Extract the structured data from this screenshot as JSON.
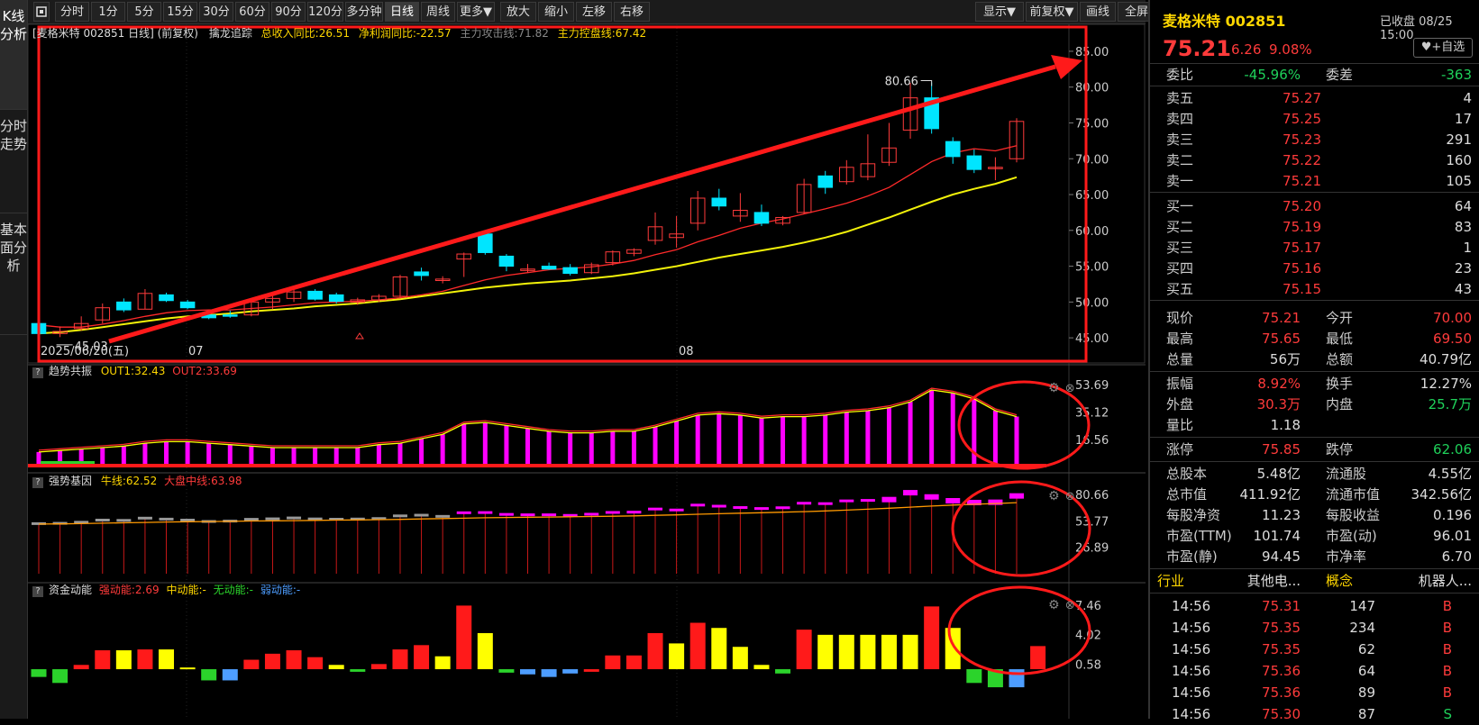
{
  "side_tabs": [
    {
      "label": "K线分析",
      "active": true
    },
    {
      "label": "分时走势",
      "active": false
    },
    {
      "label": "基本面分析",
      "active": false
    }
  ],
  "toolbar": {
    "collapse_icon": "square-icon",
    "periods": [
      "分时",
      "1分",
      "5分",
      "15分",
      "30分",
      "60分",
      "90分",
      "120分",
      "多分钟",
      "日线",
      "周线",
      "更多▼"
    ],
    "active_period": "日线",
    "actions": [
      "放大",
      "缩小",
      "左移",
      "右移"
    ],
    "right_actions": [
      "显示▼",
      "前复权▼",
      "画线",
      "全屏"
    ]
  },
  "main_chart": {
    "header": {
      "title": "[麦格米特 002851 日线] (前复权)",
      "indicator": "擒龙追踪",
      "revenue_label": "总收入同比:26.51",
      "profit_label": "净利润同比:-22.57",
      "attack_label": "主力攻击线:71.82",
      "control_label": "主力控盘线:67.42"
    },
    "price_axis": [
      "85.00",
      "80.00",
      "75.00",
      "70.00",
      "65.00",
      "60.00",
      "55.00",
      "50.00",
      "45.00"
    ],
    "date_labels": [
      "2025/06/20(五)",
      "07",
      "08"
    ],
    "high_marker": "80.66",
    "low_marker": "45.03"
  },
  "chart_data": {
    "type": "candlestick",
    "ylim": [
      42.5,
      86.5
    ],
    "candles": [
      {
        "o": 47.0,
        "h": 47.4,
        "l": 45.5,
        "c": 45.6,
        "up": false
      },
      {
        "o": 45.6,
        "h": 46.6,
        "l": 45.1,
        "c": 45.9,
        "up": true
      },
      {
        "o": 46.3,
        "h": 48.0,
        "l": 46.0,
        "c": 47.0,
        "up": true
      },
      {
        "o": 47.5,
        "h": 49.8,
        "l": 47.0,
        "c": 49.2,
        "up": true
      },
      {
        "o": 50.0,
        "h": 50.5,
        "l": 48.6,
        "c": 48.9,
        "up": false
      },
      {
        "o": 49.0,
        "h": 51.8,
        "l": 49.0,
        "c": 51.2,
        "up": true
      },
      {
        "o": 51.0,
        "h": 51.3,
        "l": 50.0,
        "c": 50.2,
        "up": false
      },
      {
        "o": 50.0,
        "h": 50.3,
        "l": 49.0,
        "c": 49.2,
        "up": false
      },
      {
        "o": 48.2,
        "h": 48.7,
        "l": 47.6,
        "c": 47.8,
        "up": false
      },
      {
        "o": 48.2,
        "h": 48.8,
        "l": 47.8,
        "c": 48.2,
        "up": false
      },
      {
        "o": 48.2,
        "h": 50.5,
        "l": 48.0,
        "c": 50.0,
        "up": true
      },
      {
        "o": 50.0,
        "h": 51.0,
        "l": 49.0,
        "c": 50.5,
        "up": true
      },
      {
        "o": 50.5,
        "h": 52.0,
        "l": 50.0,
        "c": 51.4,
        "up": true
      },
      {
        "o": 51.5,
        "h": 51.8,
        "l": 50.2,
        "c": 50.4,
        "up": false
      },
      {
        "o": 51.0,
        "h": 51.3,
        "l": 49.8,
        "c": 50.1,
        "up": false
      },
      {
        "o": 50.0,
        "h": 50.6,
        "l": 49.6,
        "c": 50.3,
        "up": true
      },
      {
        "o": 50.3,
        "h": 51.1,
        "l": 50.0,
        "c": 50.8,
        "up": true
      },
      {
        "o": 50.8,
        "h": 53.8,
        "l": 50.5,
        "c": 53.5,
        "up": true
      },
      {
        "o": 53.7,
        "h": 54.8,
        "l": 53.0,
        "c": 54.2,
        "up": false
      },
      {
        "o": 53.2,
        "h": 53.6,
        "l": 52.6,
        "c": 53.0,
        "up": true
      },
      {
        "o": 56.0,
        "h": 56.9,
        "l": 53.5,
        "c": 56.7,
        "up": true
      },
      {
        "o": 59.5,
        "h": 59.8,
        "l": 56.6,
        "c": 56.9,
        "up": false
      },
      {
        "o": 56.4,
        "h": 56.7,
        "l": 54.3,
        "c": 55.0,
        "up": false
      },
      {
        "o": 54.4,
        "h": 55.3,
        "l": 54.1,
        "c": 54.6,
        "up": true
      },
      {
        "o": 55.0,
        "h": 55.5,
        "l": 54.5,
        "c": 54.6,
        "up": false
      },
      {
        "o": 54.8,
        "h": 55.3,
        "l": 53.7,
        "c": 54.0,
        "up": false
      },
      {
        "o": 54.1,
        "h": 55.5,
        "l": 53.9,
        "c": 55.2,
        "up": true
      },
      {
        "o": 55.5,
        "h": 57.2,
        "l": 55.1,
        "c": 57.0,
        "up": true
      },
      {
        "o": 56.8,
        "h": 57.5,
        "l": 56.4,
        "c": 57.3,
        "up": true
      },
      {
        "o": 58.6,
        "h": 62.5,
        "l": 58.0,
        "c": 60.5,
        "up": true
      },
      {
        "o": 59.0,
        "h": 62.0,
        "l": 57.6,
        "c": 59.5,
        "up": true
      },
      {
        "o": 61.0,
        "h": 65.5,
        "l": 60.0,
        "c": 64.5,
        "up": true
      },
      {
        "o": 64.5,
        "h": 65.8,
        "l": 62.8,
        "c": 63.4,
        "up": false
      },
      {
        "o": 62.8,
        "h": 65.2,
        "l": 61.2,
        "c": 62.0,
        "up": true
      },
      {
        "o": 62.5,
        "h": 63.6,
        "l": 60.6,
        "c": 61.0,
        "up": false
      },
      {
        "o": 61.0,
        "h": 62.0,
        "l": 60.7,
        "c": 61.8,
        "up": true
      },
      {
        "o": 62.5,
        "h": 67.2,
        "l": 62.3,
        "c": 66.4,
        "up": true
      },
      {
        "o": 67.6,
        "h": 68.3,
        "l": 65.1,
        "c": 66.0,
        "up": false
      },
      {
        "o": 66.8,
        "h": 69.8,
        "l": 66.4,
        "c": 68.8,
        "up": true
      },
      {
        "o": 67.5,
        "h": 73.4,
        "l": 67.0,
        "c": 69.3,
        "up": true
      },
      {
        "o": 69.5,
        "h": 75.0,
        "l": 69.0,
        "c": 71.5,
        "up": true
      },
      {
        "o": 74.0,
        "h": 80.6,
        "l": 72.8,
        "c": 78.5,
        "up": true
      },
      {
        "o": 78.5,
        "h": 80.66,
        "l": 73.5,
        "c": 74.2,
        "up": false
      },
      {
        "o": 72.4,
        "h": 73.0,
        "l": 69.3,
        "c": 70.3,
        "up": false
      },
      {
        "o": 70.4,
        "h": 71.3,
        "l": 68.0,
        "c": 68.5,
        "up": false
      },
      {
        "o": 68.7,
        "h": 70.2,
        "l": 67.0,
        "c": 68.8,
        "up": true
      },
      {
        "o": 70.0,
        "h": 75.65,
        "l": 69.5,
        "c": 75.21,
        "up": true
      }
    ],
    "ma_short": [
      46.8,
      46.5,
      46.5,
      46.9,
      47.4,
      48.0,
      48.5,
      48.8,
      48.9,
      48.9,
      49.1,
      49.3,
      49.6,
      49.9,
      50.0,
      50.1,
      50.3,
      50.6,
      51.0,
      51.5,
      52.3,
      53.1,
      53.7,
      54.1,
      54.5,
      54.7,
      54.9,
      55.3,
      55.8,
      56.6,
      57.3,
      58.4,
      59.3,
      60.3,
      61.0,
      61.6,
      62.3,
      63.0,
      63.8,
      64.8,
      66.0,
      67.8,
      69.6,
      70.8,
      71.4,
      71.1,
      71.82
    ],
    "ma_long": [
      45.6,
      45.8,
      46.1,
      46.5,
      46.9,
      47.3,
      47.7,
      48.0,
      48.2,
      48.4,
      48.7,
      48.9,
      49.1,
      49.4,
      49.6,
      49.8,
      50.1,
      50.4,
      50.8,
      51.2,
      51.6,
      52.0,
      52.3,
      52.6,
      52.8,
      53.0,
      53.3,
      53.6,
      54.0,
      54.5,
      55.0,
      55.6,
      56.2,
      56.7,
      57.2,
      57.7,
      58.3,
      59.0,
      59.8,
      60.8,
      61.8,
      62.9,
      64.0,
      65.0,
      65.8,
      66.5,
      67.42
    ],
    "trend_resonance": {
      "name": "趋势共振",
      "out1": "OUT1:32.43",
      "out2": "OUT2:33.69",
      "axis": [
        "53.69",
        "35.12",
        "16.56"
      ],
      "ylim": [
        0,
        53.69
      ],
      "values": [
        8,
        9,
        10,
        11,
        12,
        14,
        15,
        15,
        14,
        13,
        12,
        11,
        11,
        11,
        11,
        11,
        13,
        14,
        17,
        20,
        27,
        28,
        26,
        24,
        22,
        21,
        21,
        22,
        22,
        25,
        29,
        33,
        34,
        33,
        31,
        32,
        32,
        33,
        35,
        36,
        38,
        42,
        50,
        48,
        44,
        36,
        32
      ]
    },
    "strong_gene": {
      "name": "强势基因",
      "bull_label": "牛线:62.52",
      "market_label": "大盘中线:63.98",
      "axis": [
        "80.66",
        "53.77",
        "26.89"
      ],
      "ylim": [
        0,
        90
      ]
    },
    "capital_momentum": {
      "name": "资金动能",
      "strong": "强动能:2.69",
      "medium": "中动能:-",
      "none": "无动能:-",
      "weak": "弱动能:-",
      "axis": [
        "7.46",
        "4.02",
        "0.58"
      ],
      "ylim": [
        -2.3,
        8.7
      ],
      "bars": [
        {
          "v": -0.9,
          "c": "green"
        },
        {
          "v": -1.6,
          "c": "green"
        },
        {
          "v": 0.5,
          "c": "red"
        },
        {
          "v": 2.2,
          "c": "red"
        },
        {
          "v": 2.2,
          "c": "yellow"
        },
        {
          "v": 2.3,
          "c": "red"
        },
        {
          "v": 2.3,
          "c": "yellow"
        },
        {
          "v": 0.2,
          "c": "yellow"
        },
        {
          "v": -1.3,
          "c": "green"
        },
        {
          "v": -1.3,
          "c": "blue"
        },
        {
          "v": 1.1,
          "c": "red"
        },
        {
          "v": 1.8,
          "c": "red"
        },
        {
          "v": 2.2,
          "c": "red"
        },
        {
          "v": 1.4,
          "c": "red"
        },
        {
          "v": 0.5,
          "c": "yellow"
        },
        {
          "v": -0.3,
          "c": "green"
        },
        {
          "v": 0.6,
          "c": "red"
        },
        {
          "v": 2.3,
          "c": "red"
        },
        {
          "v": 2.8,
          "c": "red"
        },
        {
          "v": 1.5,
          "c": "yellow"
        },
        {
          "v": 7.4,
          "c": "red"
        },
        {
          "v": 4.2,
          "c": "yellow"
        },
        {
          "v": -0.4,
          "c": "green"
        },
        {
          "v": -0.6,
          "c": "blue"
        },
        {
          "v": -0.9,
          "c": "blue"
        },
        {
          "v": -0.5,
          "c": "blue"
        },
        {
          "v": -0.3,
          "c": "red"
        },
        {
          "v": 1.6,
          "c": "red"
        },
        {
          "v": 1.6,
          "c": "red"
        },
        {
          "v": 4.2,
          "c": "red"
        },
        {
          "v": 3.0,
          "c": "yellow"
        },
        {
          "v": 5.4,
          "c": "red"
        },
        {
          "v": 4.8,
          "c": "yellow"
        },
        {
          "v": 2.6,
          "c": "yellow"
        },
        {
          "v": 0.5,
          "c": "yellow"
        },
        {
          "v": -0.5,
          "c": "green"
        },
        {
          "v": 4.6,
          "c": "red"
        },
        {
          "v": 4.0,
          "c": "yellow"
        },
        {
          "v": 4.0,
          "c": "yellow"
        },
        {
          "v": 4.0,
          "c": "yellow"
        },
        {
          "v": 4.0,
          "c": "yellow"
        },
        {
          "v": 4.0,
          "c": "yellow"
        },
        {
          "v": 7.3,
          "c": "red"
        },
        {
          "v": 4.8,
          "c": "yellow"
        },
        {
          "v": -1.6,
          "c": "green"
        },
        {
          "v": -2.1,
          "c": "green"
        },
        {
          "v": -2.1,
          "c": "blue"
        },
        {
          "v": 2.69,
          "c": "red"
        }
      ]
    }
  },
  "quote": {
    "name_code": "麦格米特 002851",
    "status": "已收盘 08/25 15:00",
    "price": "75.21",
    "change": "6.26",
    "change_pct": "9.08%",
    "watch_button": "+自选",
    "weibi_label": "委比",
    "weibi": "-45.96%",
    "weicha_label": "委差",
    "weicha": "-363",
    "asks": [
      {
        "label": "卖五",
        "price": "75.27",
        "vol": "4"
      },
      {
        "label": "卖四",
        "price": "75.25",
        "vol": "17"
      },
      {
        "label": "卖三",
        "price": "75.23",
        "vol": "291"
      },
      {
        "label": "卖二",
        "price": "75.22",
        "vol": "160"
      },
      {
        "label": "卖一",
        "price": "75.21",
        "vol": "105"
      }
    ],
    "bids": [
      {
        "label": "买一",
        "price": "75.20",
        "vol": "64"
      },
      {
        "label": "买二",
        "price": "75.19",
        "vol": "83"
      },
      {
        "label": "买三",
        "price": "75.17",
        "vol": "1"
      },
      {
        "label": "买四",
        "price": "75.16",
        "vol": "23"
      },
      {
        "label": "买五",
        "price": "75.15",
        "vol": "43"
      }
    ],
    "stats1": [
      {
        "l1": "现价",
        "v1": "75.21",
        "c1": "red",
        "l2": "今开",
        "v2": "70.00",
        "c2": "red"
      },
      {
        "l1": "最高",
        "v1": "75.65",
        "c1": "red",
        "l2": "最低",
        "v2": "69.50",
        "c2": "red"
      },
      {
        "l1": "总量",
        "v1": "56万",
        "c1": "white",
        "l2": "总额",
        "v2": "40.79亿",
        "c2": "white"
      }
    ],
    "stats2": [
      {
        "l1": "振幅",
        "v1": "8.92%",
        "c1": "red",
        "l2": "换手",
        "v2": "12.27%",
        "c2": "white"
      },
      {
        "l1": "外盘",
        "v1": "30.3万",
        "c1": "red",
        "l2": "内盘",
        "v2": "25.7万",
        "c2": "green"
      },
      {
        "l1": "量比",
        "v1": "1.18",
        "c1": "white",
        "l2": "",
        "v2": "",
        "c2": "white"
      }
    ],
    "stats3": [
      {
        "l1": "涨停",
        "v1": "75.85",
        "c1": "red",
        "l2": "跌停",
        "v2": "62.06",
        "c2": "green"
      }
    ],
    "stats4": [
      {
        "l1": "总股本",
        "v1": "5.48亿",
        "c1": "white",
        "l2": "流通股",
        "v2": "4.55亿",
        "c2": "white"
      },
      {
        "l1": "总市值",
        "v1": "411.92亿",
        "c1": "white",
        "l2": "流通市值",
        "v2": "342.56亿",
        "c2": "white"
      },
      {
        "l1": "每股净资",
        "v1": "11.23",
        "c1": "white",
        "l2": "每股收益",
        "v2": "0.196",
        "c2": "white"
      },
      {
        "l1": "市盈(TTM)",
        "v1": "101.74",
        "c1": "white",
        "l2": "市盈(动)",
        "v2": "96.01",
        "c2": "white"
      },
      {
        "l1": "市盈(静)",
        "v1": "94.45",
        "c1": "white",
        "l2": "市净率",
        "v2": "6.70",
        "c2": "white"
      }
    ],
    "industry_label": "行业",
    "industry": "其他电...",
    "concept_label": "概念",
    "concept": "机器人...",
    "ticks": [
      {
        "time": "14:56",
        "price": "75.31",
        "vol": "147",
        "side": "B"
      },
      {
        "time": "14:56",
        "price": "75.35",
        "vol": "234",
        "side": "B"
      },
      {
        "time": "14:56",
        "price": "75.35",
        "vol": "62",
        "side": "B"
      },
      {
        "time": "14:56",
        "price": "75.36",
        "vol": "64",
        "side": "B"
      },
      {
        "time": "14:56",
        "price": "75.36",
        "vol": "89",
        "side": "B"
      },
      {
        "time": "14:56",
        "price": "75.30",
        "vol": "87",
        "side": "S"
      }
    ]
  },
  "colors": {
    "up": "#ff3b3b",
    "down": "#00e5ff",
    "ma_short": "#ff2a2a",
    "ma_long": "#f2f20a",
    "annotation": "#ff1a1a",
    "magenta": "#ff00ff",
    "bar_yellow": "#ffff00",
    "bar_green": "#2bd32b",
    "bar_blue": "#4d9dff"
  }
}
